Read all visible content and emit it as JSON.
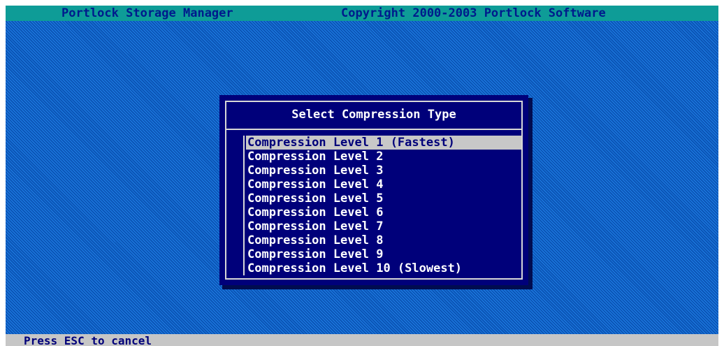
{
  "header": {
    "app_title": "Portlock Storage Manager",
    "copyright": "Copyright 2000-2003 Portlock Software"
  },
  "dialog": {
    "title": "Select Compression Type",
    "selected_index": 0,
    "items": [
      {
        "label": "Compression Level 1 (Fastest)"
      },
      {
        "label": "Compression Level 2"
      },
      {
        "label": "Compression Level 3"
      },
      {
        "label": "Compression Level 4"
      },
      {
        "label": "Compression Level 5"
      },
      {
        "label": "Compression Level 6"
      },
      {
        "label": "Compression Level 7"
      },
      {
        "label": "Compression Level 8"
      },
      {
        "label": "Compression Level 9"
      },
      {
        "label": "Compression Level 10 (Slowest)"
      }
    ]
  },
  "status_bar": {
    "text": "Press ESC to cancel"
  },
  "colors": {
    "title_bar_bg": "#0e9c97",
    "title_text": "#001a8c",
    "desktop_blue": "#0b62c9",
    "dialog_bg": "#00007a",
    "highlight_bg": "#c8c8c8",
    "status_bar_bg": "#c6c6c6"
  }
}
